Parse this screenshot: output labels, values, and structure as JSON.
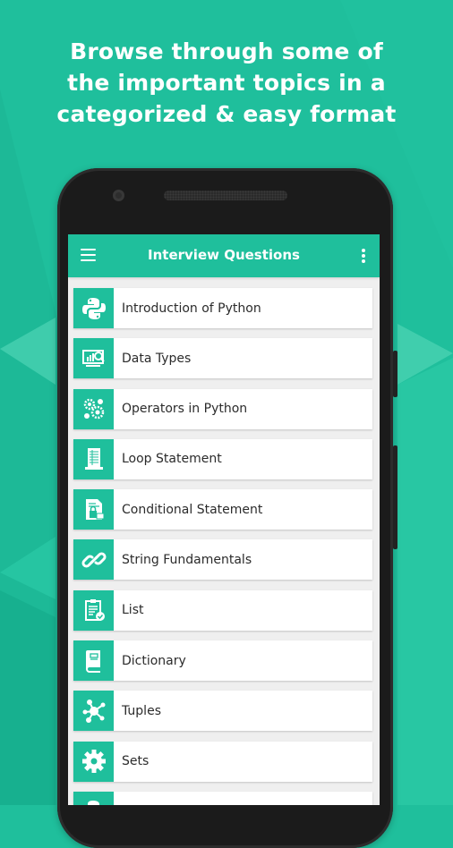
{
  "promo": {
    "headline_lines": [
      "Browse through some of",
      "the important topics in a",
      "categorized & easy format"
    ]
  },
  "colors": {
    "accent": "#1fbf9c",
    "phone_body": "#1b1b1b",
    "list_bg": "#efefef",
    "text": "#2b2b2b"
  },
  "appbar": {
    "title": "Interview Questions",
    "menu_icon": "hamburger-menu-icon",
    "more_icon": "more-vertical-icon"
  },
  "topics": [
    {
      "label": "Introduction of Python",
      "icon": "python-logo-icon"
    },
    {
      "label": "Data Types",
      "icon": "monitor-chart-search-icon"
    },
    {
      "label": "Operators in Python",
      "icon": "gears-icon"
    },
    {
      "label": "Loop Statement",
      "icon": "document-list-icon"
    },
    {
      "label": "Conditional Statement",
      "icon": "document-lock-icon"
    },
    {
      "label": "String Fundamentals",
      "icon": "link-icon"
    },
    {
      "label": "List",
      "icon": "clipboard-check-icon"
    },
    {
      "label": "Dictionary",
      "icon": "book-icon"
    },
    {
      "label": "Tuples",
      "icon": "network-nodes-icon"
    },
    {
      "label": "Sets",
      "icon": "gear-icon"
    },
    {
      "label": "",
      "icon": "python-logo-icon"
    }
  ]
}
